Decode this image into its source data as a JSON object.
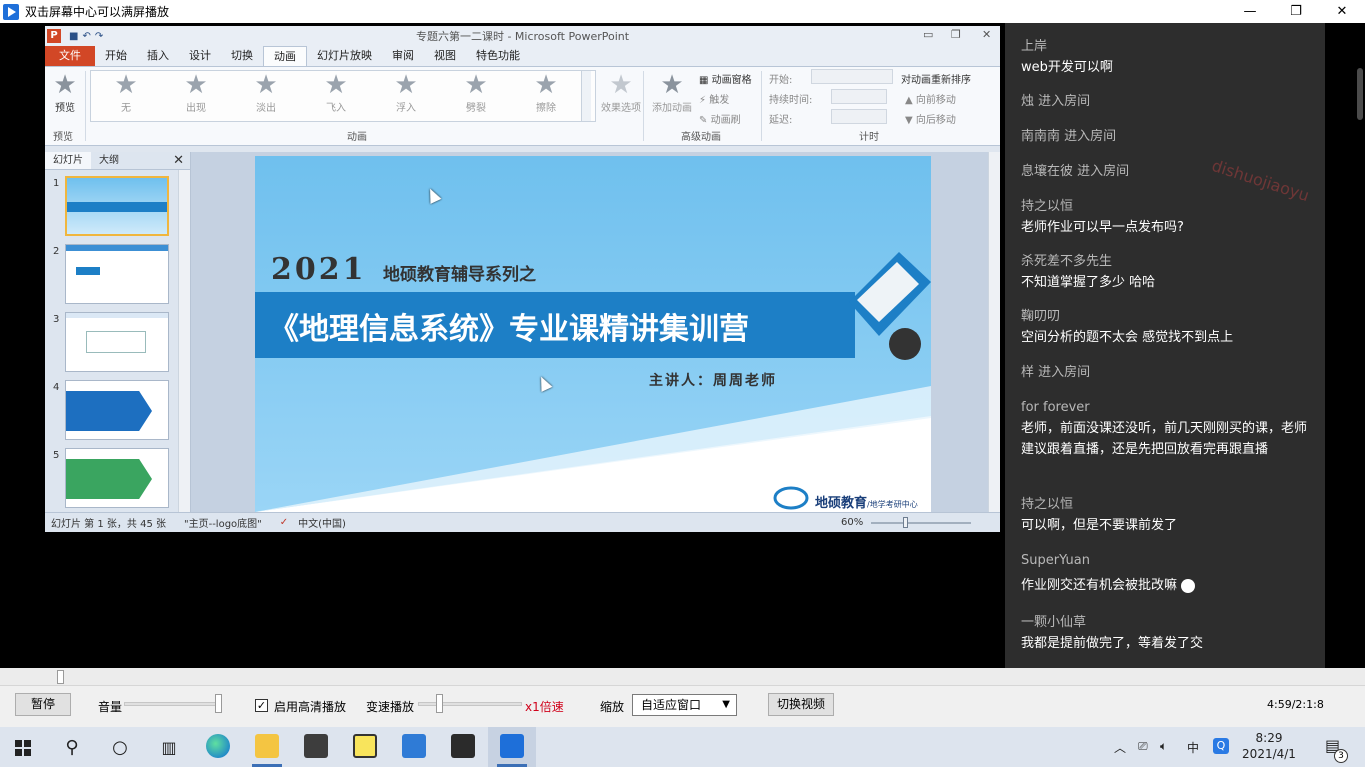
{
  "window": {
    "title": "双击屏幕中心可以满屏播放",
    "minimize": "—",
    "maximize": "❐",
    "close": "✕"
  },
  "ppt": {
    "title": "专题六第一二课时 - Microsoft PowerPoint",
    "logo": "P",
    "tabs": [
      "文件",
      "开始",
      "插入",
      "设计",
      "切换",
      "动画",
      "幻灯片放映",
      "审阅",
      "视图",
      "特色功能"
    ],
    "active_tab": "动画",
    "ribbon": {
      "preview": "预览",
      "preview_group": "预览",
      "gallery": [
        "无",
        "出现",
        "淡出",
        "飞入",
        "浮入",
        "劈裂",
        "擦除"
      ],
      "effect_options": "效果选项",
      "animation_group": "动画",
      "add_animation": "添加动画",
      "animation_pane": "动画窗格",
      "trigger": "触发",
      "animation_painter": "动画刷",
      "advanced_group": "高级动画",
      "start": "开始:",
      "duration": "持续时间:",
      "delay": "延迟:",
      "timing_group": "计时",
      "reorder": "对动画重新排序",
      "move_earlier": "向前移动",
      "move_later": "向后移动"
    },
    "slide_panel": {
      "tab_slides": "幻灯片",
      "tab_outline": "大纲",
      "close": "✕",
      "numbers": [
        "1",
        "2",
        "3",
        "4",
        "5"
      ]
    },
    "slide": {
      "year": "2021",
      "series": "地硕教育辅导系列之",
      "headline": "《地理信息系统》专业课精讲集训营",
      "lecturer": "主讲人：周周老师",
      "brand": "地硕教育",
      "brand_sub": "/地学考研中心"
    },
    "status": {
      "slide_count": "幻灯片 第 1 张，共 45 张",
      "theme": "\"主页--logo底图\"",
      "language": "中文(中国)",
      "zoom": "60%"
    }
  },
  "chat": {
    "watermark": "dishuojiaoyu",
    "messages": [
      {
        "user": "上岸",
        "text": "web开发可以啊"
      },
      {
        "user": "烛 进入房间",
        "text": ""
      },
      {
        "user": "南南南 进入房间",
        "text": ""
      },
      {
        "user": "息壤在彼 进入房间",
        "text": ""
      },
      {
        "user": "持之以恒",
        "text": "老师作业可以早一点发布吗?"
      },
      {
        "user": "杀死差不多先生",
        "text": "不知道掌握了多少 哈哈"
      },
      {
        "user": "鞠叨叨",
        "text": "空间分析的题不太会 感觉找不到点上"
      },
      {
        "user": "样 进入房间",
        "text": ""
      },
      {
        "user": "for forever",
        "text": "老师，前面没课还没听，前几天刚刚买的课，老师建议跟着直播，还是先把回放看完再跟直播"
      },
      {
        "user": "持之以恒",
        "text": "可以啊，但是不要课前发了"
      },
      {
        "user": "SuperYuan",
        "text": "作业刚交还有机会被批改嘛"
      },
      {
        "user": "一颗小仙草",
        "text": "我都是提前做完了，等着发了交"
      }
    ]
  },
  "controls": {
    "pause": "暂停",
    "volume": "音量",
    "hd_checked": "✓",
    "hd": "启用高清播放",
    "speed_label": "变速播放",
    "speed_value": "x1倍速",
    "zoom_label": "缩放",
    "zoom_value": "自适应窗口",
    "switch_video": "切换视频",
    "time": "4:59/2:1:8"
  },
  "taskbar": {
    "time": "8:29",
    "date": "2021/4/1",
    "ime": "中",
    "notifications": "3"
  },
  "colors": {
    "ppt_file_tab": "#d24726",
    "slide_band": "#1d7fc6",
    "chat_bg": "#2d2d2d"
  }
}
